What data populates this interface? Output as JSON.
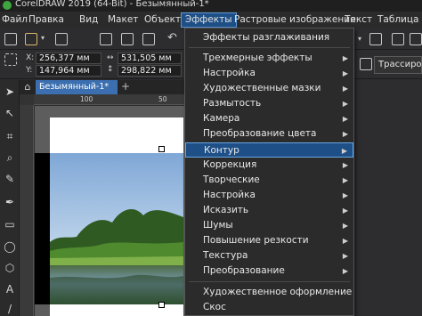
{
  "window": {
    "title": "CorelDRAW 2019 (64-Bit) - Безымянный-1*"
  },
  "menubar": {
    "items": [
      {
        "label": "Файл"
      },
      {
        "label": "Правка"
      },
      {
        "label": "Вид"
      },
      {
        "label": "Макет"
      },
      {
        "label": "Объект"
      },
      {
        "label": "Эффекты"
      },
      {
        "label": "Растровые изображения"
      },
      {
        "label": "Текст"
      },
      {
        "label": "Таблица"
      }
    ],
    "active_index": 5
  },
  "propertybar": {
    "x_label": "X:",
    "y_label": "Y:",
    "x_value": "256,377 мм",
    "y_value": "147,964 мм",
    "w_value": "531,505 мм",
    "h_value": "298,822 мм",
    "trace_label": "Трассирова"
  },
  "document": {
    "tab_label": "Безымянный-1*",
    "add_tab_symbol": "+"
  },
  "ruler": {
    "top_ticks": [
      "100",
      "50"
    ]
  },
  "effects_menu": {
    "items": [
      {
        "label": "Эффекты разглаживания",
        "submenu": false
      },
      {
        "sep": true
      },
      {
        "label": "Трехмерные эффекты",
        "submenu": true
      },
      {
        "label": "Настройка",
        "submenu": true
      },
      {
        "label": "Художественные мазки",
        "submenu": true
      },
      {
        "label": "Размытость",
        "submenu": true
      },
      {
        "label": "Камера",
        "submenu": true
      },
      {
        "label": "Преобразование цвета",
        "submenu": true
      },
      {
        "label": "Контур",
        "submenu": true,
        "highlighted": true
      },
      {
        "label": "Коррекция",
        "submenu": true
      },
      {
        "label": "Творческие",
        "submenu": true
      },
      {
        "label": "Настройка",
        "submenu": true
      },
      {
        "label": "Исказить",
        "submenu": true
      },
      {
        "label": "Шумы",
        "submenu": true
      },
      {
        "label": "Повышение резкости",
        "submenu": true
      },
      {
        "label": "Текстура",
        "submenu": true
      },
      {
        "label": "Преобразование",
        "submenu": true
      },
      {
        "sep": true
      },
      {
        "label": "Художественное оформление",
        "submenu": false
      },
      {
        "label": "Скос",
        "submenu": false
      }
    ]
  },
  "colors": {
    "accent": "#1e4f86",
    "tab_active": "#3b6fb0",
    "logo": "#3ea63e"
  }
}
